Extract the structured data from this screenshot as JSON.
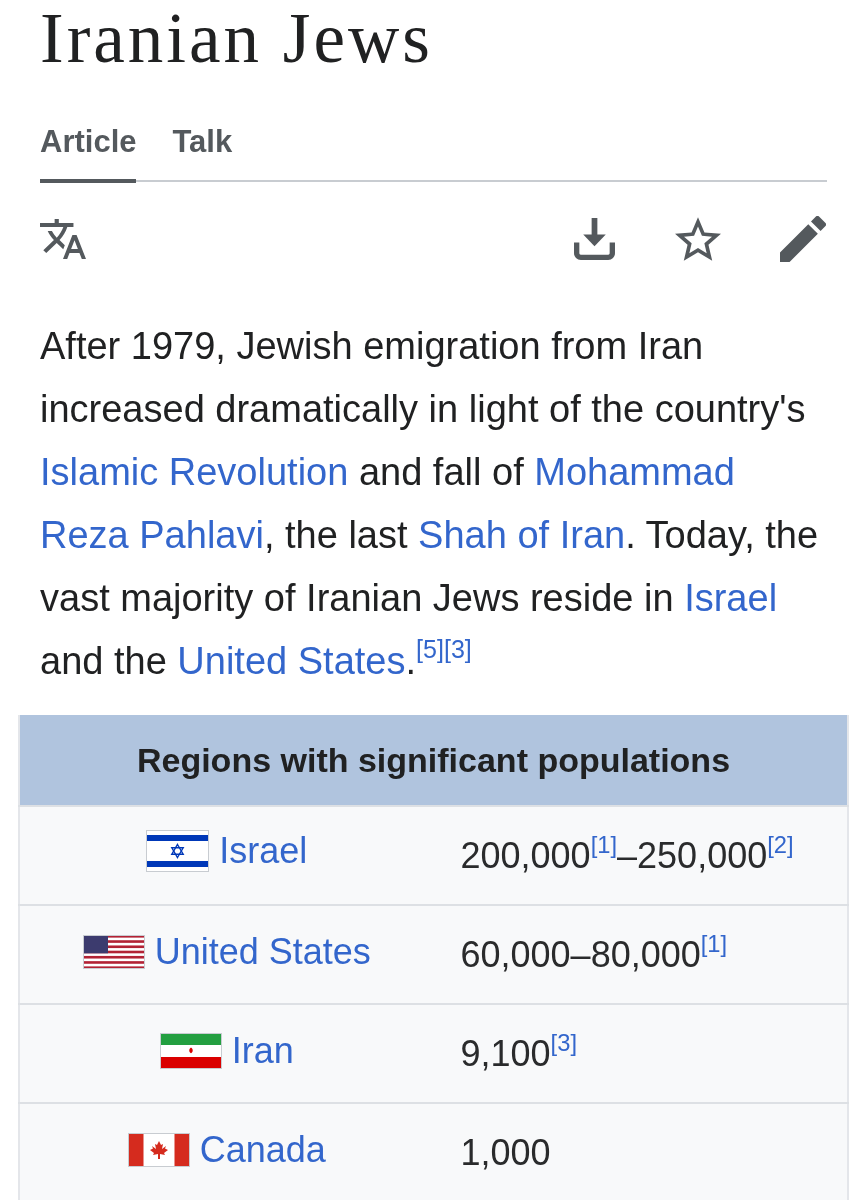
{
  "page": {
    "title": "Iranian Jews"
  },
  "tabs": [
    {
      "label": "Article",
      "selected": true
    },
    {
      "label": "Talk",
      "selected": false
    }
  ],
  "paragraph": {
    "segments": [
      {
        "kind": "text",
        "text": "After 1979, Jewish emigration from Iran increased dramatically in light of the country's "
      },
      {
        "kind": "link",
        "text": "Islamic Revolution"
      },
      {
        "kind": "text",
        "text": " and fall of "
      },
      {
        "kind": "link",
        "text": "Mohammad "
      },
      {
        "kind": "link",
        "text": "Reza Pahlavi"
      },
      {
        "kind": "text",
        "text": ", the last "
      },
      {
        "kind": "link",
        "text": "Shah of Iran"
      },
      {
        "kind": "text",
        "text": ". Today, the vast majority of Iranian Jews reside in "
      },
      {
        "kind": "link",
        "text": "Israel"
      },
      {
        "kind": "text",
        "text": " and the "
      },
      {
        "kind": "link",
        "text": "United States"
      },
      {
        "kind": "text",
        "text": "."
      },
      {
        "kind": "citation",
        "text": "[5]"
      },
      {
        "kind": "citation",
        "text": "[3]"
      }
    ]
  },
  "infobox": {
    "heading": "Regions with significant populations",
    "rows": [
      {
        "kind": "israel",
        "country": "Israel",
        "population": [
          {
            "kind": "text",
            "text": "200,000"
          },
          {
            "kind": "citation",
            "text": "[1]"
          },
          {
            "kind": "text",
            "text": "–250,000"
          },
          {
            "kind": "citation",
            "text": "[2]"
          }
        ]
      },
      {
        "kind": "usa",
        "country": "United States",
        "population": [
          {
            "kind": "text",
            "text": "60,000–80,000"
          },
          {
            "kind": "citation",
            "text": "[1]"
          }
        ]
      },
      {
        "kind": "iran",
        "country": "Iran",
        "population": [
          {
            "kind": "text",
            "text": "9,100"
          },
          {
            "kind": "citation",
            "text": "[3]"
          }
        ]
      },
      {
        "kind": "canada",
        "country": "Canada",
        "population": [
          {
            "kind": "text",
            "text": "1,000"
          }
        ]
      }
    ]
  }
}
